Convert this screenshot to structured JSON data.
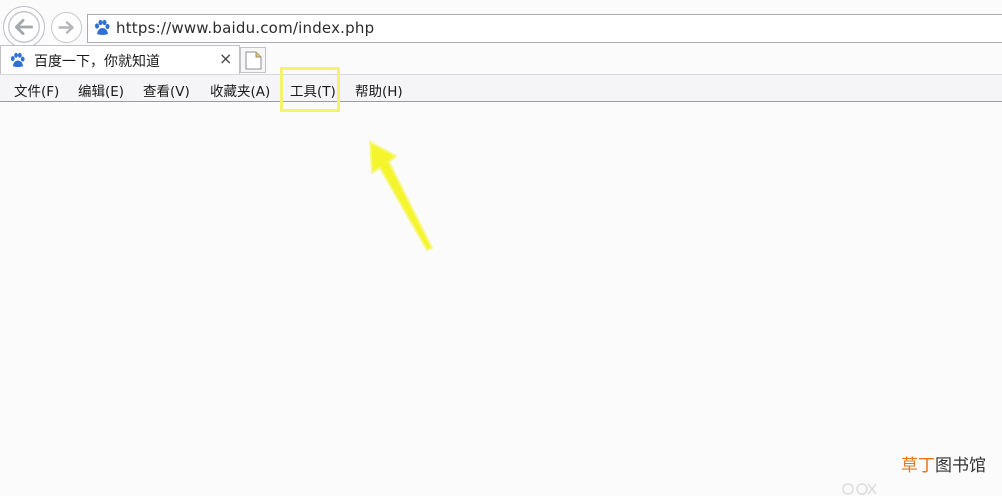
{
  "browser": {
    "address_bar": {
      "url": "https://www.baidu.com/index.php"
    },
    "tab": {
      "title": "百度一下，你就知道",
      "close_label": "×"
    }
  },
  "menu_bar": {
    "items": [
      {
        "label": "文件(F)"
      },
      {
        "label": "编辑(E)"
      },
      {
        "label": "查看(V)"
      },
      {
        "label": "收藏夹(A)"
      },
      {
        "label": "工具(T)"
      },
      {
        "label": "帮助(H)"
      }
    ],
    "highlighted_item": "工具(T)"
  },
  "annotation": {
    "highlight_color": "#f3f46a",
    "arrow_color": "#f4f52a"
  },
  "watermark": {
    "accent_text": "草丁",
    "text": "图书馆"
  },
  "icons": {
    "back": "back-arrow-icon",
    "forward": "forward-arrow-icon",
    "site": "baidu-paw-icon",
    "new_tab": "new-tab-icon"
  }
}
